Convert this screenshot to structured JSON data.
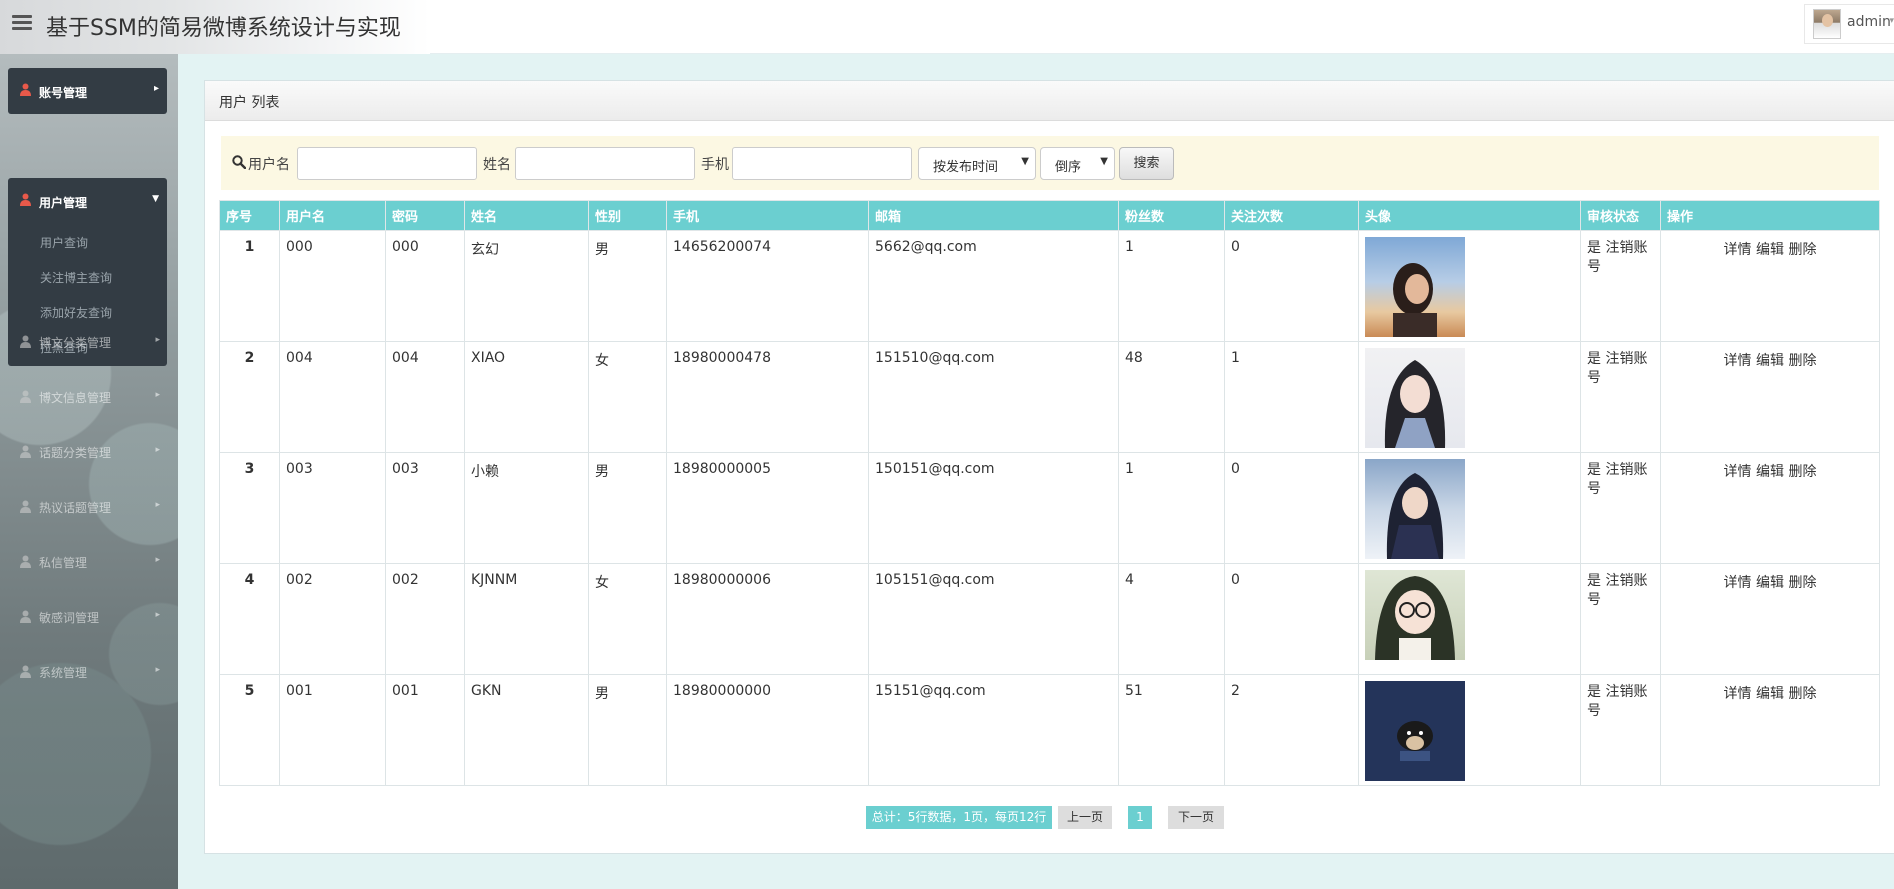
{
  "header": {
    "title": "基于SSM的简易微博系统设计与实现",
    "user_name": "admin"
  },
  "sidebar": {
    "account": "账号管理",
    "user": "用户管理",
    "sub_items": [
      "用户查询",
      "关注博主查询",
      "添加好友查询",
      "拉黑查询"
    ],
    "faded_items": [
      "博文分类管理",
      "博文信息管理",
      "话题分类管理",
      "热议话题管理",
      "私信管理",
      "敏感词管理",
      "系统管理"
    ]
  },
  "panel": {
    "title": "用户 列表"
  },
  "search": {
    "username_label": "用户名",
    "name_label": "姓名",
    "phone_label": "手机",
    "sort_select": "按发布时间",
    "order_select": "倒序",
    "search_button": "搜索"
  },
  "table": {
    "headers": [
      "序号",
      "用户名",
      "密码",
      "姓名",
      "性别",
      "手机",
      "邮箱",
      "粉丝数",
      "关注次数",
      "头像",
      "审核状态",
      "操作"
    ],
    "rows": [
      {
        "seq": "1",
        "username": "000",
        "password": "000",
        "name": "玄幻",
        "gender": "男",
        "phone": "14656200074",
        "email": "5662@qq.com",
        "fans": "1",
        "follows": "0"
      },
      {
        "seq": "2",
        "username": "004",
        "password": "004",
        "name": "XIAO",
        "gender": "女",
        "phone": "18980000478",
        "email": "151510@qq.com",
        "fans": "48",
        "follows": "1"
      },
      {
        "seq": "3",
        "username": "003",
        "password": "003",
        "name": "小赖",
        "gender": "男",
        "phone": "18980000005",
        "email": "150151@qq.com",
        "fans": "1",
        "follows": "0"
      },
      {
        "seq": "4",
        "username": "002",
        "password": "002",
        "name": "KJNNM",
        "gender": "女",
        "phone": "18980000006",
        "email": "105151@qq.com",
        "fans": "4",
        "follows": "0"
      },
      {
        "seq": "5",
        "username": "001",
        "password": "001",
        "name": "GKN",
        "gender": "男",
        "phone": "18980000000",
        "email": "15151@qq.com",
        "fans": "51",
        "follows": "2"
      }
    ],
    "audit_status": "是",
    "audit_action": "注销账号",
    "op_detail": "详情",
    "op_edit": "编辑",
    "op_delete": "删除"
  },
  "pagination": {
    "total": "总计：5行数据，1页，每页12行",
    "prev": "上一页",
    "page": "1",
    "next": "下一页"
  },
  "colors": {
    "accent": "#6bcfd0",
    "sidebar_item": "#333c44",
    "search_bg": "#fcf8e3",
    "icon_red": "#e8594a"
  }
}
